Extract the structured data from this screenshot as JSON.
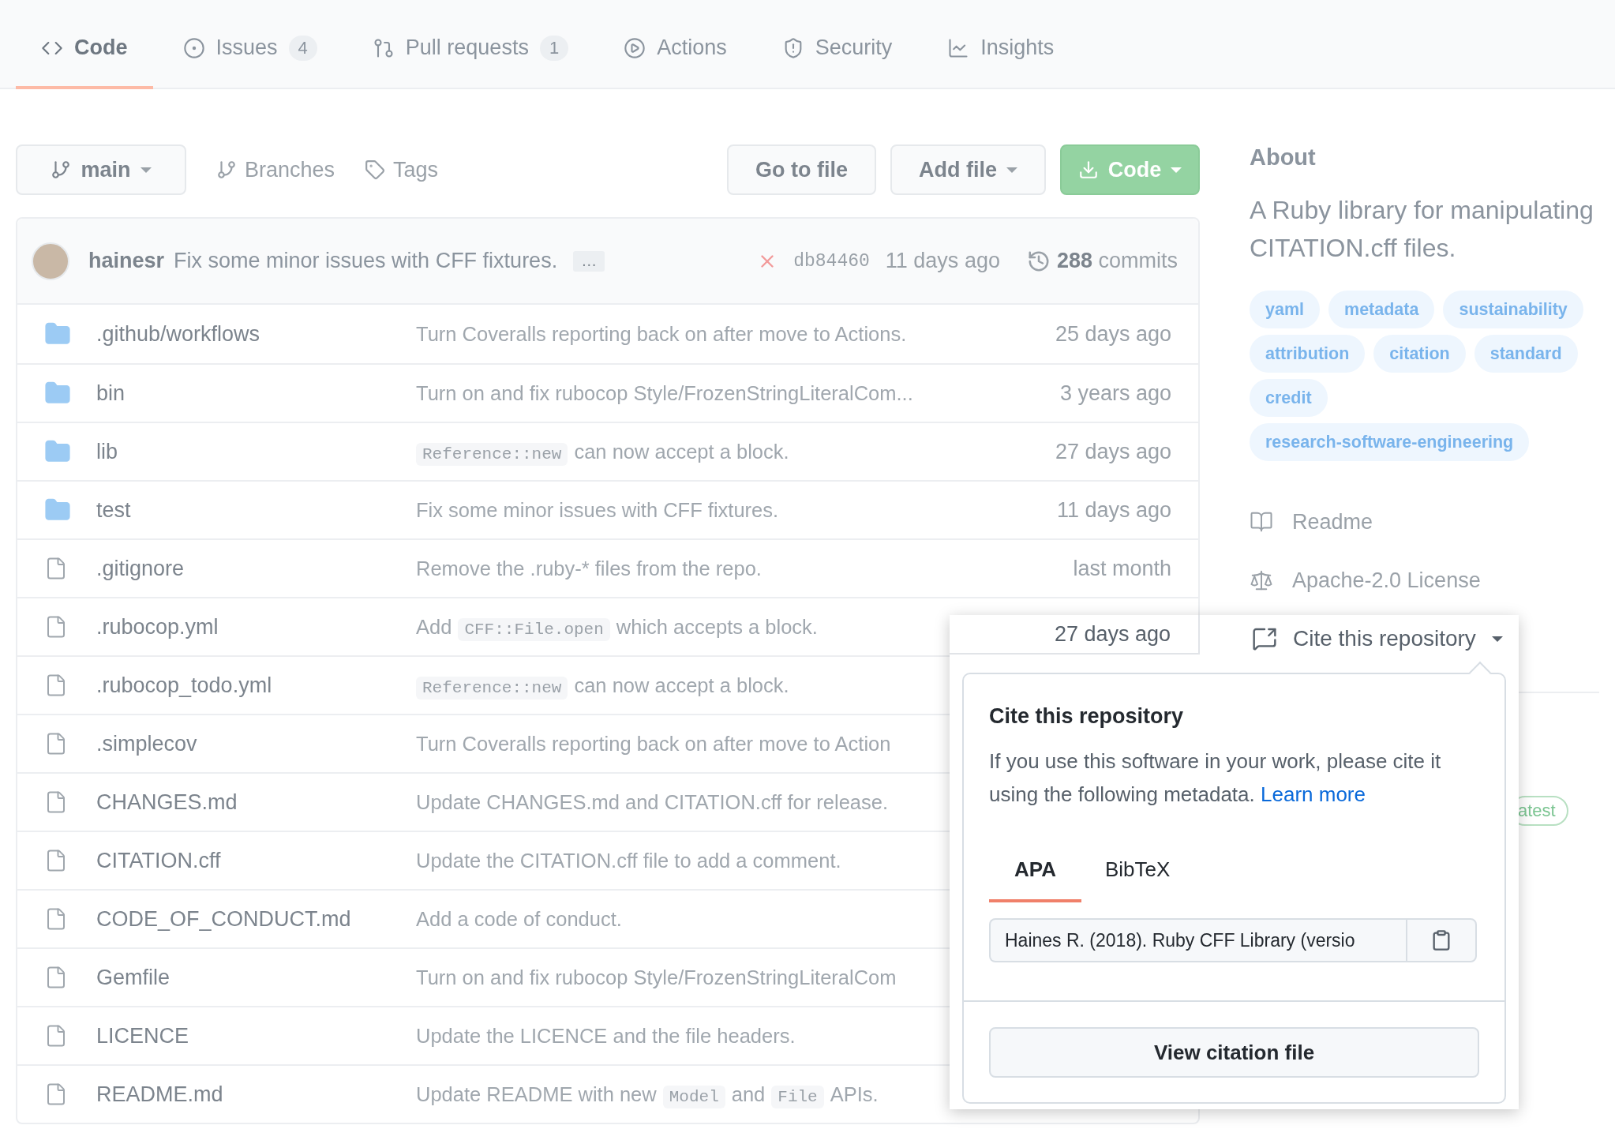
{
  "repo_tabs": [
    {
      "label": "Code",
      "selected": true
    },
    {
      "label": "Issues",
      "counter": "4",
      "selected": false
    },
    {
      "label": "Pull requests",
      "counter": "1",
      "selected": false
    },
    {
      "label": "Actions",
      "selected": false
    },
    {
      "label": "Security",
      "selected": false
    },
    {
      "label": "Insights",
      "selected": false
    }
  ],
  "toolbar": {
    "branch": "main",
    "branches_link": "Branches",
    "tags_link": "Tags",
    "go_to_file": "Go to file",
    "add_file": "Add file",
    "code_button": "Code"
  },
  "latest_commit": {
    "author": "hainesr",
    "message": "Fix some minor issues with CFF fixtures.",
    "more": "…",
    "checks_failed": true,
    "sha": "db84460",
    "time": "11 days ago",
    "commits": "**288** commits"
  },
  "files": [
    {
      "kind": "folder",
      "name": ".github/workflows",
      "message": "Turn Coveralls reporting back on after move to Actions.",
      "date": "25 days ago"
    },
    {
      "kind": "folder",
      "name": "bin",
      "message": "Turn on and fix rubocop Style/FrozenStringLiteralCom...",
      "date": "3 years ago"
    },
    {
      "kind": "folder",
      "name": "lib",
      "message": [
        {
          "kind": "code",
          "text": "Reference::new"
        },
        {
          "kind": "text",
          "text": "can now accept a block."
        }
      ],
      "date": "27 days ago"
    },
    {
      "kind": "folder",
      "name": "test",
      "message": "Fix some minor issues with CFF fixtures.",
      "date": "11 days ago"
    },
    {
      "kind": "file",
      "name": ".gitignore",
      "message": "Remove the .ruby-* files from the repo.",
      "date": "last month"
    },
    {
      "kind": "file",
      "name": ".rubocop.yml",
      "message": [
        {
          "kind": "text",
          "text": "Add"
        },
        {
          "kind": "code",
          "text": "CFF::File.open"
        },
        {
          "kind": "text",
          "text": "which accepts a block."
        }
      ]
    },
    {
      "kind": "file",
      "name": ".rubocop_todo.yml",
      "message": [
        {
          "kind": "code",
          "text": "Reference::new"
        },
        {
          "kind": "text",
          "text": "can now accept a block."
        }
      ]
    },
    {
      "kind": "file",
      "name": ".simplecov",
      "message": "Turn Coveralls reporting back on after move to Action"
    },
    {
      "kind": "file",
      "name": "CHANGES.md",
      "message": "Update CHANGES.md and CITATION.cff for release."
    },
    {
      "kind": "file",
      "name": "CITATION.cff",
      "message": "Update the CITATION.cff file to add a comment."
    },
    {
      "kind": "file",
      "name": "CODE_OF_CONDUCT.md",
      "message": "Add a code of conduct."
    },
    {
      "kind": "file",
      "name": "Gemfile",
      "message": "Turn on and fix rubocop Style/FrozenStringLiteralCom"
    },
    {
      "kind": "file",
      "name": "LICENCE",
      "message": "Update the LICENCE and the file headers."
    },
    {
      "kind": "file",
      "name": "README.md",
      "message": [
        {
          "kind": "text",
          "text": "Update README with new"
        },
        {
          "kind": "code",
          "text": "Model"
        },
        {
          "kind": "text",
          "text": "and"
        },
        {
          "kind": "code",
          "text": "File"
        },
        {
          "kind": "text",
          "text": "APIs."
        }
      ]
    }
  ],
  "about": {
    "title": "About",
    "description": "A Ruby library for manipulating CITATION.cff files.",
    "topics": [
      "yaml",
      "metadata",
      "sustainability",
      "attribution",
      "citation",
      "standard",
      "credit",
      "research-software-engineering"
    ],
    "links": [
      {
        "kind": "readme",
        "label": "Readme"
      },
      {
        "kind": "license",
        "label": "Apache-2.0 License"
      }
    ],
    "release_badge": "atest"
  },
  "cite_popup": {
    "row_date": "27 days ago",
    "button": "Cite this repository",
    "title": "Cite this repository",
    "text": "If you use this software in your work, please cite it using the following metadata.",
    "link": "Learn more",
    "tabs": [
      {
        "label": "APA",
        "selected": true
      },
      {
        "label": "BibTeX",
        "selected": false
      }
    ],
    "citation": "Haines R. (2018). Ruby CFF Library (versio",
    "view_button": "View citation file"
  }
}
